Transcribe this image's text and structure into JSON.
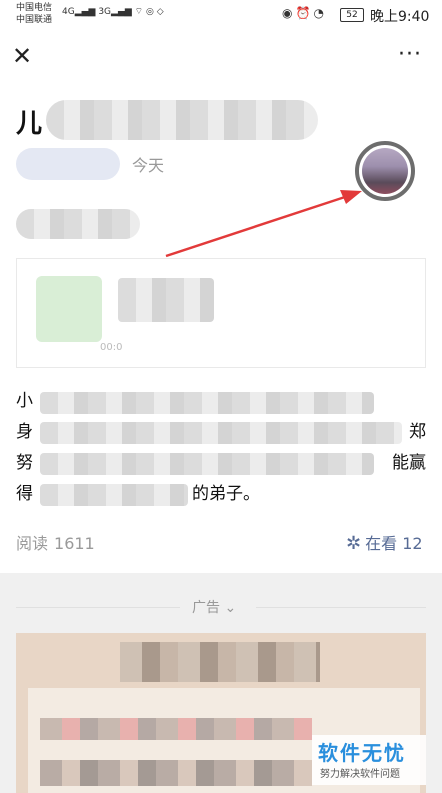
{
  "status_bar": {
    "carrier1": "中国电信",
    "carrier2": "中国联通",
    "signal1": "4G",
    "signal2": "3G",
    "battery": "52",
    "time": "晚上9:40"
  },
  "nav": {
    "close_icon": "close-icon",
    "more_icon": "more-icon"
  },
  "article": {
    "title_first_char": "儿",
    "date": "今天",
    "para": {
      "l1_start": "小",
      "l2_start": "身",
      "l2_end": "郑",
      "l3_start": "努",
      "l3_end": "能赢",
      "l4_start": "得",
      "l4_end": "的弟子。"
    },
    "card_time": "00:0"
  },
  "stats": {
    "reads_label": "阅读",
    "reads_count": "1611",
    "looking_label": "在看",
    "looking_count": "12"
  },
  "ad": {
    "label": "广告"
  },
  "watermark": {
    "title": "软件无忧",
    "subtitle": "努力解决软件问题"
  }
}
